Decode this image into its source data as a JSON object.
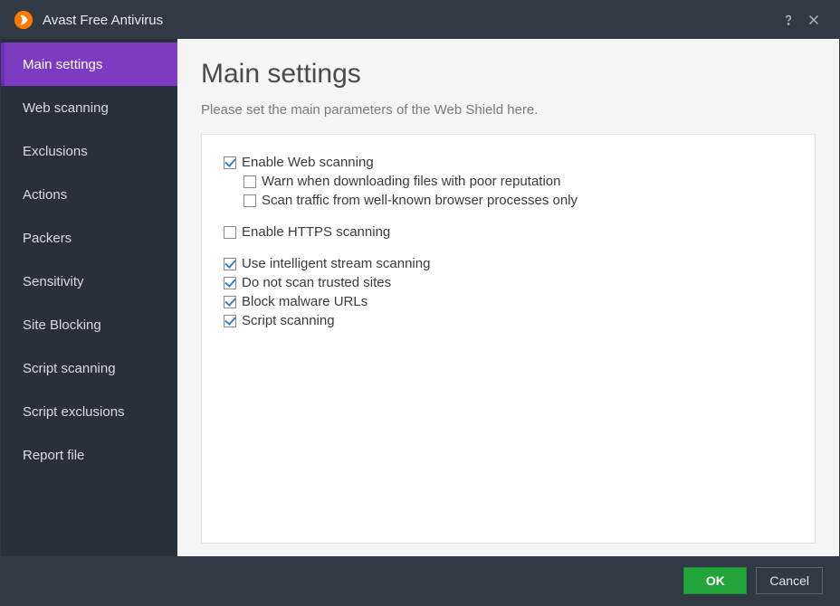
{
  "app": {
    "title": "Avast Free Antivirus"
  },
  "sidebar": {
    "items": [
      {
        "label": "Main settings",
        "active": true
      },
      {
        "label": "Web scanning",
        "active": false
      },
      {
        "label": "Exclusions",
        "active": false
      },
      {
        "label": "Actions",
        "active": false
      },
      {
        "label": "Packers",
        "active": false
      },
      {
        "label": "Sensitivity",
        "active": false
      },
      {
        "label": "Site Blocking",
        "active": false
      },
      {
        "label": "Script scanning",
        "active": false
      },
      {
        "label": "Script exclusions",
        "active": false
      },
      {
        "label": "Report file",
        "active": false
      }
    ]
  },
  "main": {
    "heading": "Main settings",
    "subtitle": "Please set the main parameters of the Web Shield here.",
    "options": {
      "enable_web_scanning": {
        "label": "Enable Web scanning",
        "checked": true
      },
      "warn_poor_reputation": {
        "label": "Warn when downloading files with poor reputation",
        "checked": false
      },
      "scan_known_browsers": {
        "label": "Scan traffic from well-known browser processes only",
        "checked": false
      },
      "enable_https_scanning": {
        "label": "Enable HTTPS scanning",
        "checked": false
      },
      "intelligent_stream": {
        "label": "Use intelligent stream scanning",
        "checked": true
      },
      "dont_scan_trusted": {
        "label": "Do not scan trusted sites",
        "checked": true
      },
      "block_malware_urls": {
        "label": "Block malware URLs",
        "checked": true
      },
      "script_scanning": {
        "label": "Script scanning",
        "checked": true
      }
    }
  },
  "footer": {
    "ok": "OK",
    "cancel": "Cancel"
  },
  "colors": {
    "accent": "#7c3bc2",
    "primary_button": "#22a53b",
    "sidebar_bg": "#283039",
    "titlebar_bg": "#313944"
  }
}
